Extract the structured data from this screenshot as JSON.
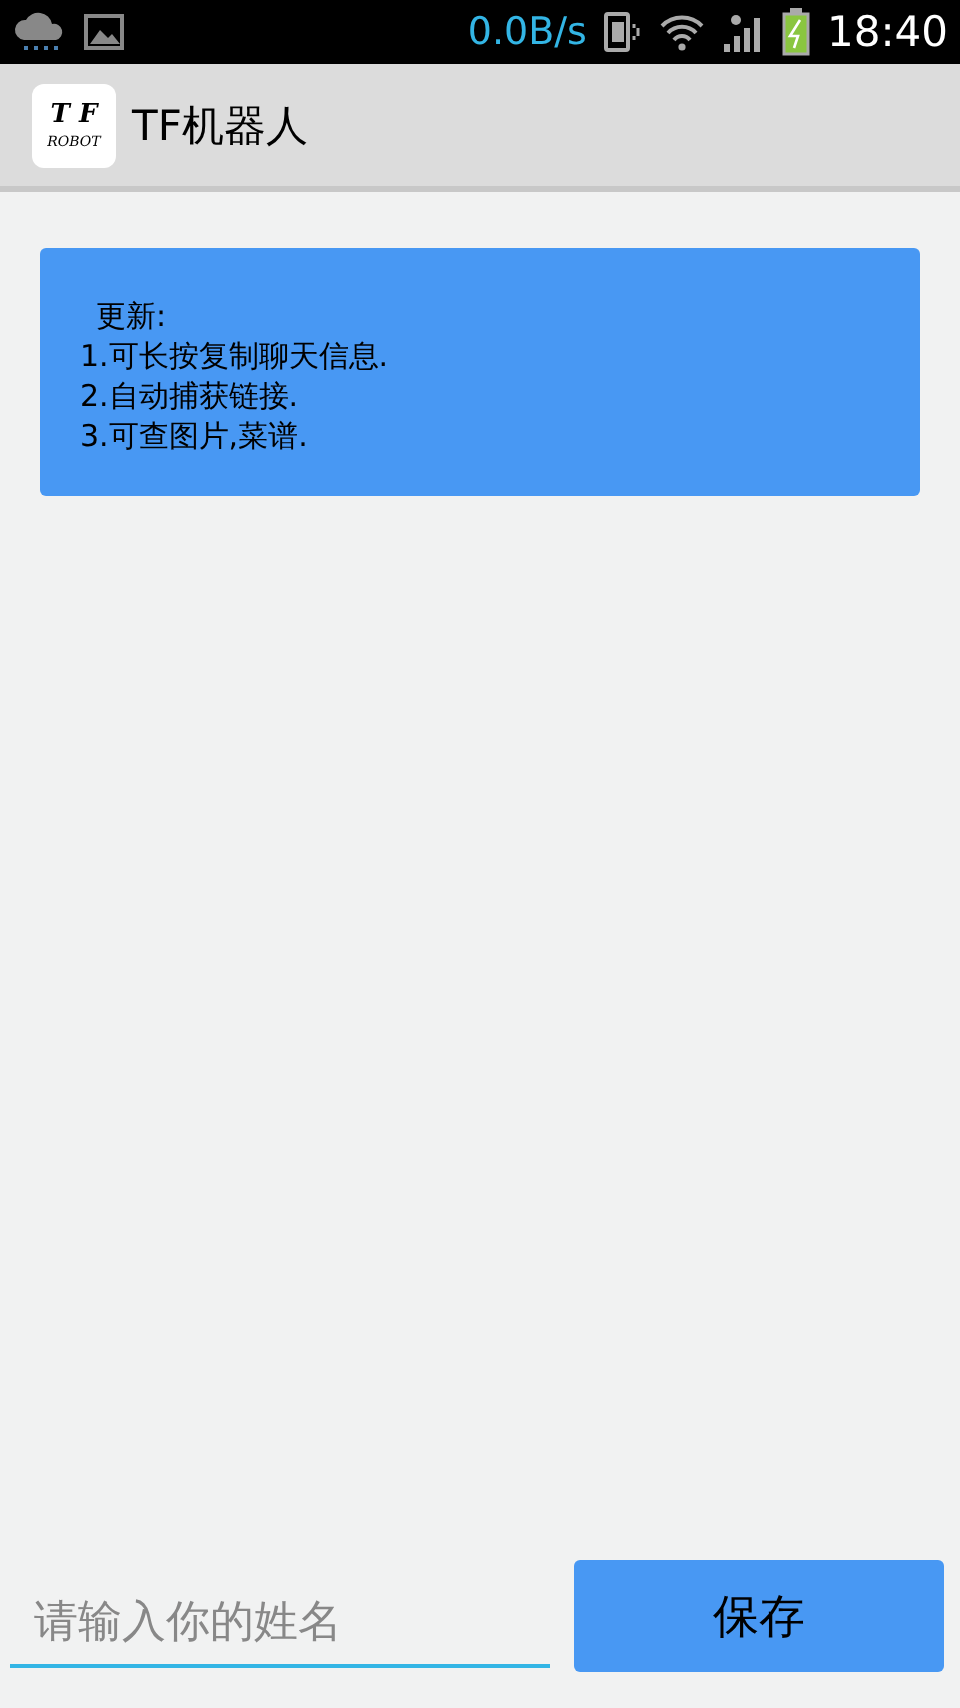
{
  "status_bar": {
    "network_speed": "0.0B/s",
    "time": "18:40"
  },
  "app_bar": {
    "logo_top": "T F",
    "logo_bottom": "ROBOT",
    "title": "TF机器人"
  },
  "notice": {
    "heading": "更新:",
    "lines": [
      "1.可长按复制聊天信息.",
      "2.自动捕获链接.",
      "3.可查图片,菜谱."
    ]
  },
  "name_field": {
    "placeholder": "请输入你的姓名"
  },
  "save_button": {
    "label": "保存"
  }
}
